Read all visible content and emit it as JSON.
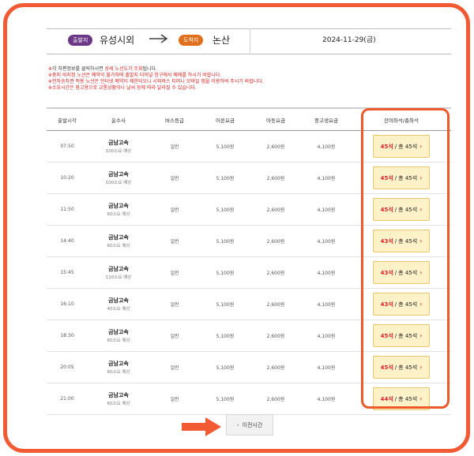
{
  "route": {
    "departure_tag": "출발지",
    "departure": "유성시외",
    "arrival_tag": "도착지",
    "arrival": "논산",
    "date": "2024-11-29(금)"
  },
  "notices": [
    {
      "mark": "※",
      "text": "각 차편정보를 클릭하시면 ",
      "highlight": "상세 노선도가 조회",
      "text2": "됩니다."
    },
    {
      "mark": "※",
      "text": "중지 비지정 노선은 예약이 불가하며 출발지 터미널 창구에서 예매를 하시기 바랍니다.",
      "highlight": "",
      "text2": ""
    },
    {
      "mark": "※",
      "text": "전자승차권 적용 노선은 인터넷 예약이 제한되오니 시외버스 티머니 모바일 앱을 이용하여 주시기 바랍니다.",
      "highlight": "",
      "text2": ""
    },
    {
      "mark": "※",
      "text": "소요시간은 참고용으로 교통상황이나 날씨 등에 따라 달라질 수 있습니다.",
      "highlight": "",
      "text2": ""
    }
  ],
  "table": {
    "headers": [
      "출발시각",
      "운수사",
      "버스등급",
      "어른요금",
      "아동요금",
      "중고생요금",
      "잔여좌석/총좌석"
    ],
    "rows": [
      {
        "time": "07:50",
        "company": "금남고속",
        "duration": "100소요 예상",
        "grade": "일반",
        "adult": "5,100원",
        "child": "2,600원",
        "student": "4,100원",
        "remaining": "45석",
        "total": "총 45석"
      },
      {
        "time": "10:20",
        "company": "금남고속",
        "duration": "100소요 예상",
        "grade": "일반",
        "adult": "5,100원",
        "child": "2,600원",
        "student": "4,100원",
        "remaining": "45석",
        "total": "총 45석"
      },
      {
        "time": "11:50",
        "company": "금남고속",
        "duration": "60소요 예상",
        "grade": "일반",
        "adult": "5,100원",
        "child": "2,600원",
        "student": "4,100원",
        "remaining": "45석",
        "total": "총 45석"
      },
      {
        "time": "14:40",
        "company": "금남고속",
        "duration": "60소요 예상",
        "grade": "일반",
        "adult": "5,100원",
        "child": "2,600원",
        "student": "4,100원",
        "remaining": "43석",
        "total": "총 45석"
      },
      {
        "time": "15:45",
        "company": "금남고속",
        "duration": "110소요 예상",
        "grade": "일반",
        "adult": "5,100원",
        "child": "2,600원",
        "student": "4,100원",
        "remaining": "43석",
        "total": "총 45석"
      },
      {
        "time": "16:10",
        "company": "금남고속",
        "duration": "40소요 예상",
        "grade": "일반",
        "adult": "5,100원",
        "child": "2,600원",
        "student": "4,100원",
        "remaining": "43석",
        "total": "총 45석"
      },
      {
        "time": "18:30",
        "company": "금남고속",
        "duration": "60소요 예상",
        "grade": "일반",
        "adult": "5,100원",
        "child": "2,600원",
        "student": "4,100원",
        "remaining": "45석",
        "total": "총 45석"
      },
      {
        "time": "20:05",
        "company": "금남고속",
        "duration": "60소요 예상",
        "grade": "일반",
        "adult": "5,100원",
        "child": "2,600원",
        "student": "4,100원",
        "remaining": "45석",
        "total": "총 45석"
      },
      {
        "time": "21:00",
        "company": "금남고속",
        "duration": "60소요 예상",
        "grade": "일반",
        "adult": "5,100원",
        "child": "2,600원",
        "student": "4,100원",
        "remaining": "44석",
        "total": "총 45석"
      }
    ]
  },
  "pagination": {
    "prev_label": "이전시간"
  },
  "colors": {
    "frame": "#f25a33",
    "departure_pill": "#6a3886",
    "arrival_pill": "#e0701e",
    "remaining_seats": "#e0202a",
    "seat_button_bg": "#fff2c8"
  }
}
